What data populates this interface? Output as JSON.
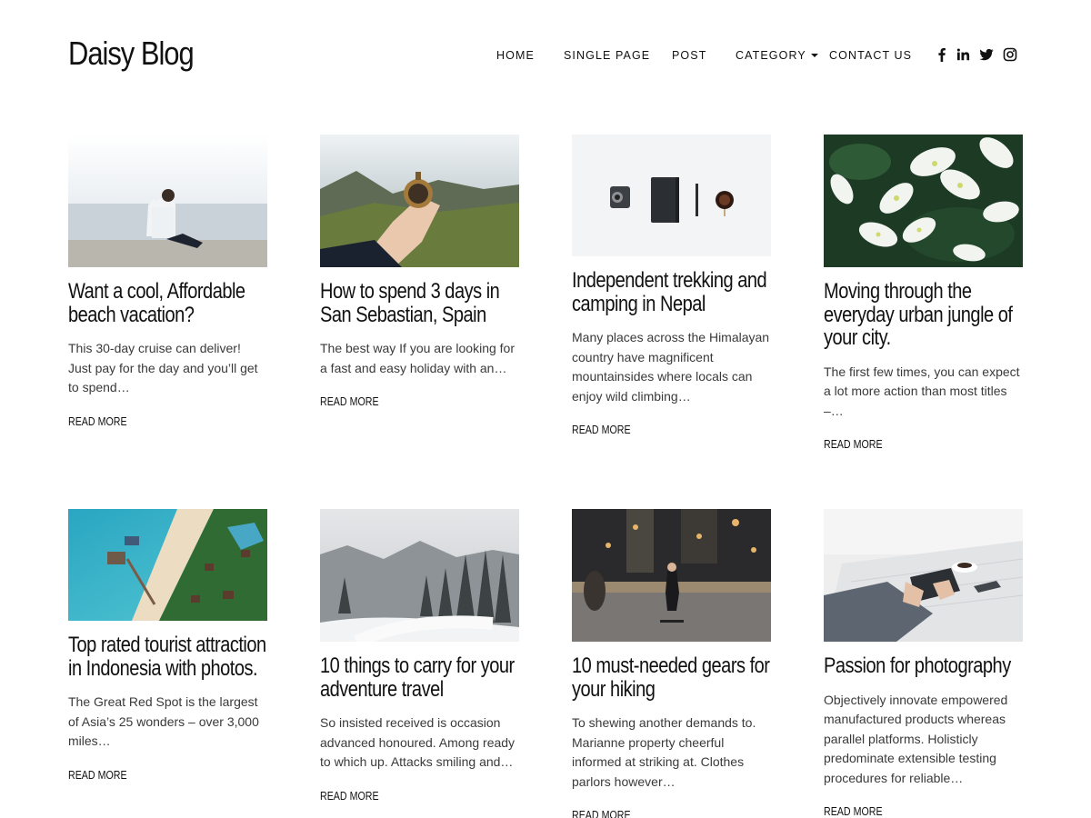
{
  "site": {
    "title": "Daisy Blog"
  },
  "nav": {
    "items": [
      {
        "label": "HOME"
      },
      {
        "label": "SINGLE PAGE"
      },
      {
        "label": "POST"
      },
      {
        "label": "CATEGORY"
      },
      {
        "label": "CONTACT US"
      }
    ]
  },
  "social": [
    "facebook-icon",
    "linkedin-icon",
    "twitter-icon",
    "instagram-icon"
  ],
  "posts": [
    {
      "title": "Want a cool, Affordable beach vacation?",
      "excerpt": "This 30-day cruise can deliver! Just pay for the day and you’ll get to spend…",
      "more": "READ MORE",
      "image": "man sitting on beach looking at sea"
    },
    {
      "title": "How to spend 3 days in San Sebastian, Spain",
      "excerpt": "The best way If you are looking for a fast and easy holiday with an…",
      "more": "READ MORE",
      "image": "hand holding compass over mountains"
    },
    {
      "title": "Independent trekking and camping in Nepal",
      "excerpt": "Many places across the Himalayan country have magnificent mountainsides where locals can enjoy wild climbing…",
      "more": "READ MORE",
      "image": "camera notebook pen and coffee on white desk"
    },
    {
      "title": "Moving through the everyday urban jungle of your city.",
      "excerpt": "The first few times, you can expect a lot more action than most titles –…",
      "more": "READ MORE",
      "image": "white flowers on dark green leaves"
    },
    {
      "title": "Top rated tourist attraction in Indonesia with photos.",
      "excerpt": "The Great Red Spot is the largest of Asia’s 25 wonders – over 3,000 miles…",
      "more": "READ MORE",
      "image": "aerial view of tropical beach with pier"
    },
    {
      "title": "10 things to carry for your adventure travel",
      "excerpt": "So insisted received is occasion advanced honoured. Among ready to which up. Attacks smiling and…",
      "more": "READ MORE",
      "image": "snowy pine forest and road"
    },
    {
      "title": "10 must-needed gears for your hiking",
      "excerpt": "To shewing another demands to. Marianne property cheerful informed at striking at. Clothes parlors however…",
      "more": "READ MORE",
      "image": "skateboarder on city street at night"
    },
    {
      "title": "Passion for photography",
      "excerpt": "Objectively innovate empowered manufactured products whereas parallel platforms. Holisticly predominate extensible testing procedures for reliable…",
      "more": "READ MORE",
      "image": "hands holding tablet at table with coffee"
    }
  ]
}
